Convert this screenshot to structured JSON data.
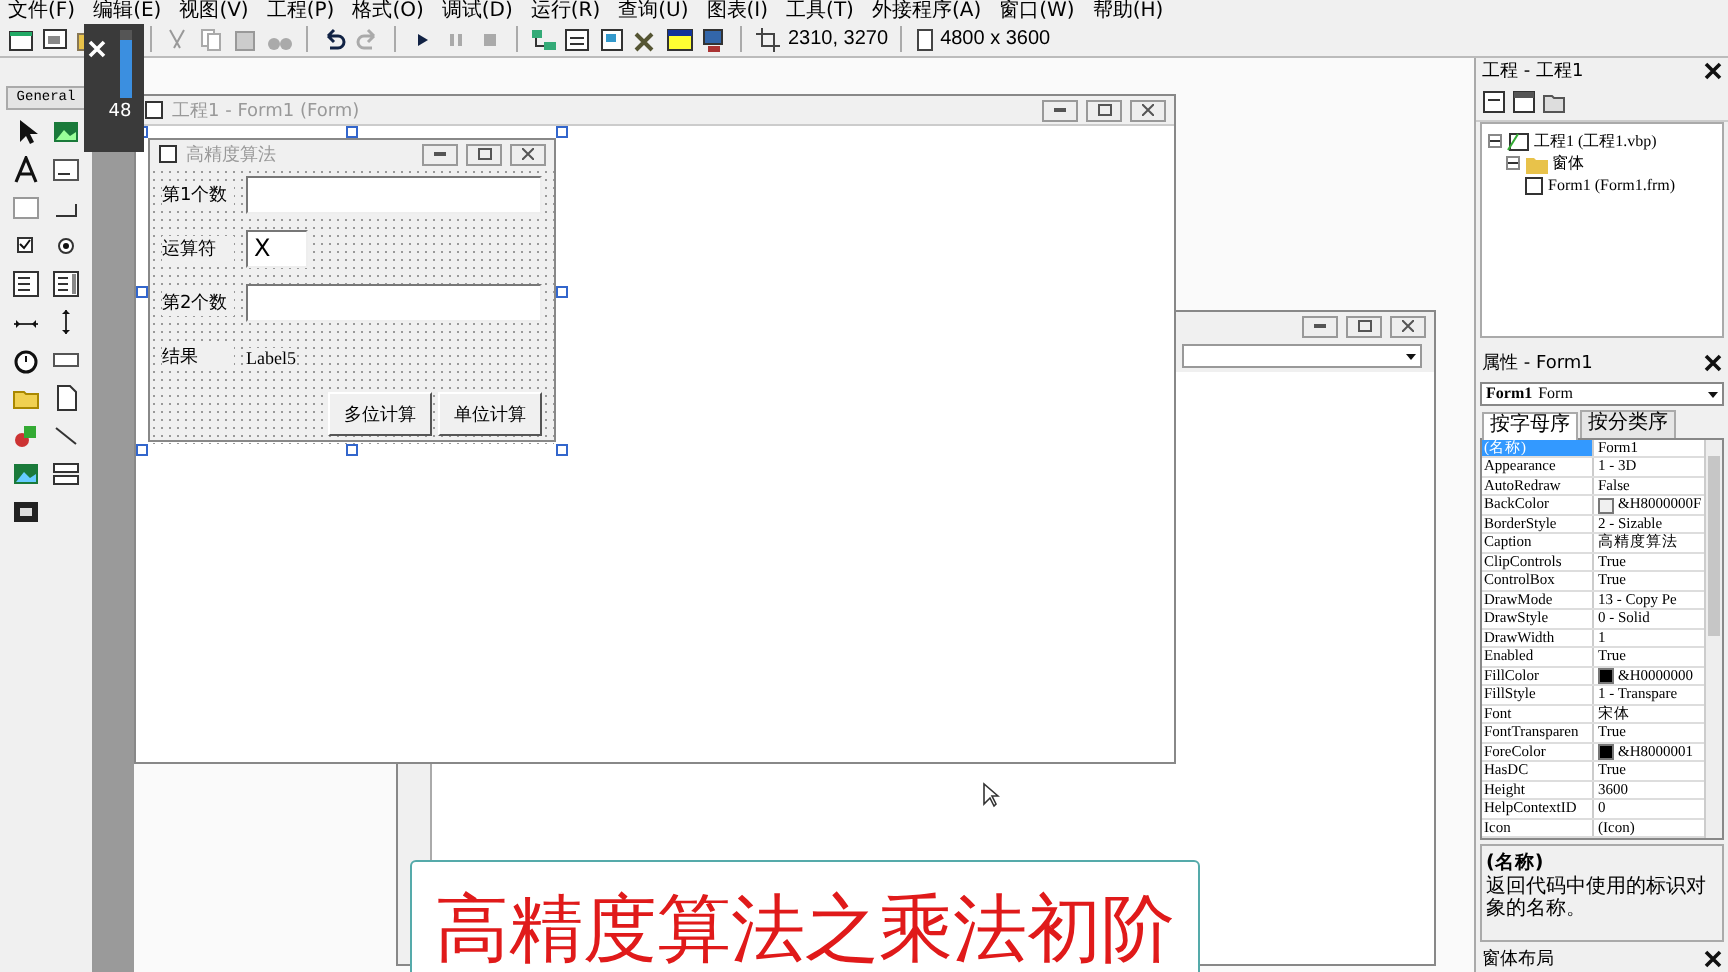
{
  "menu": [
    "文件(F)",
    "编辑(E)",
    "视图(V)",
    "工程(P)",
    "格式(O)",
    "调试(D)",
    "运行(R)",
    "查询(U)",
    "图表(I)",
    "工具(T)",
    "外接程序(A)",
    "窗口(W)",
    "帮助(H)"
  ],
  "toolbar": {
    "position": "2310, 3270",
    "size": "4800 x 3600"
  },
  "volume_overlay": {
    "value": "48",
    "level": 0.85
  },
  "toolbox": {
    "tab": "General"
  },
  "designer": {
    "title": "工程1 - Form1 (Form)",
    "form": {
      "caption": "高精度算法",
      "rows": [
        {
          "kind": "field",
          "label": "第1个数",
          "value": ""
        },
        {
          "kind": "operator",
          "label": "运算符",
          "value": "X"
        },
        {
          "kind": "field",
          "label": "第2个数",
          "value": ""
        },
        {
          "kind": "result",
          "label": "结果",
          "value": "Label5"
        }
      ],
      "buttons": [
        "多位计算",
        "单位计算"
      ]
    }
  },
  "project": {
    "title": "工程 - 工程1",
    "tree": [
      {
        "label": "工程1 (工程1.vbp)",
        "expanded": true,
        "children": [
          {
            "label": "窗体",
            "expanded": true,
            "children": [
              {
                "label": "Form1 (Form1.frm)"
              }
            ]
          }
        ]
      }
    ]
  },
  "properties": {
    "title": "属性 - Form1",
    "object_name": "Form1",
    "object_type": "Form",
    "tabs": [
      {
        "label": "按字母序",
        "selected": true
      },
      {
        "label": "按分类序",
        "selected": false
      }
    ],
    "rows": [
      {
        "name": "(名称)",
        "value": "Form1",
        "selected": true
      },
      {
        "name": "Appearance",
        "value": "1 - 3D",
        "selected": false
      },
      {
        "name": "AutoRedraw",
        "value": "False",
        "selected": false
      },
      {
        "name": "BackColor",
        "value": "&H8000000F",
        "color": "#f0f0f0",
        "selected": false
      },
      {
        "name": "BorderStyle",
        "value": "2 - Sizable",
        "selected": false
      },
      {
        "name": "Caption",
        "value": "高精度算法",
        "selected": false
      },
      {
        "name": "ClipControls",
        "value": "True",
        "selected": false
      },
      {
        "name": "ControlBox",
        "value": "True",
        "selected": false
      },
      {
        "name": "DrawMode",
        "value": "13 - Copy Pe",
        "selected": false
      },
      {
        "name": "DrawStyle",
        "value": "0 - Solid",
        "selected": false
      },
      {
        "name": "DrawWidth",
        "value": "1",
        "selected": false
      },
      {
        "name": "Enabled",
        "value": "True",
        "selected": false
      },
      {
        "name": "FillColor",
        "value": "&H0000000",
        "color": "#000000",
        "selected": false
      },
      {
        "name": "FillStyle",
        "value": "1 - Transpare",
        "selected": false
      },
      {
        "name": "Font",
        "value": "宋体",
        "selected": false
      },
      {
        "name": "FontTransparen",
        "value": "True",
        "selected": false
      },
      {
        "name": "ForeColor",
        "value": "&H8000001",
        "color": "#000000",
        "selected": false
      },
      {
        "name": "HasDC",
        "value": "True",
        "selected": false
      },
      {
        "name": "Height",
        "value": "3600",
        "selected": false
      },
      {
        "name": "HelpContextID",
        "value": "0",
        "selected": false
      },
      {
        "name": "Icon",
        "value": "(Icon)",
        "selected": false
      }
    ],
    "description_title": "(名称)",
    "description": "返回代码中使用的标识对象的名称。"
  },
  "form_layout": {
    "title": "窗体布局"
  },
  "subtitle": "高精度算法之乘法初阶"
}
